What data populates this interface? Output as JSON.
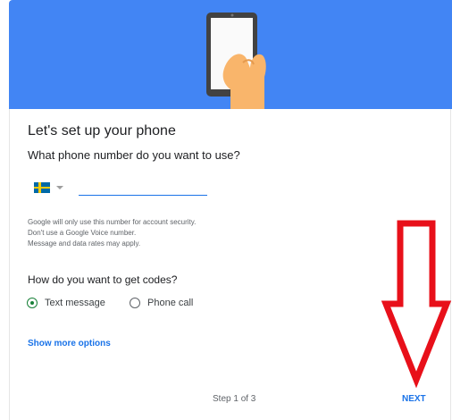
{
  "hero": {
    "illustration": "hand-holding-phone-illustration",
    "color": "#4285f4"
  },
  "title": "Let's set up your phone",
  "question": "What phone number do you want to use?",
  "country": {
    "flag": "sweden-flag-icon",
    "dropdown_icon": "caret-down-icon"
  },
  "phone_input": {
    "value": "",
    "placeholder": ""
  },
  "notes": [
    "Google will only use this number for account security.",
    "Don't use a Google Voice number.",
    "Message and data rates may apply."
  ],
  "codes_question": "How do you want to get codes?",
  "options": [
    {
      "label": "Text message",
      "selected": true
    },
    {
      "label": "Phone call",
      "selected": false
    }
  ],
  "show_more": "Show more options",
  "footer": {
    "step": "Step 1 of 3",
    "next": "NEXT"
  },
  "annotation": {
    "type": "red-down-arrow",
    "color": "#e8101a"
  },
  "colors": {
    "accent": "#1a73e8",
    "radio": "#188038"
  }
}
